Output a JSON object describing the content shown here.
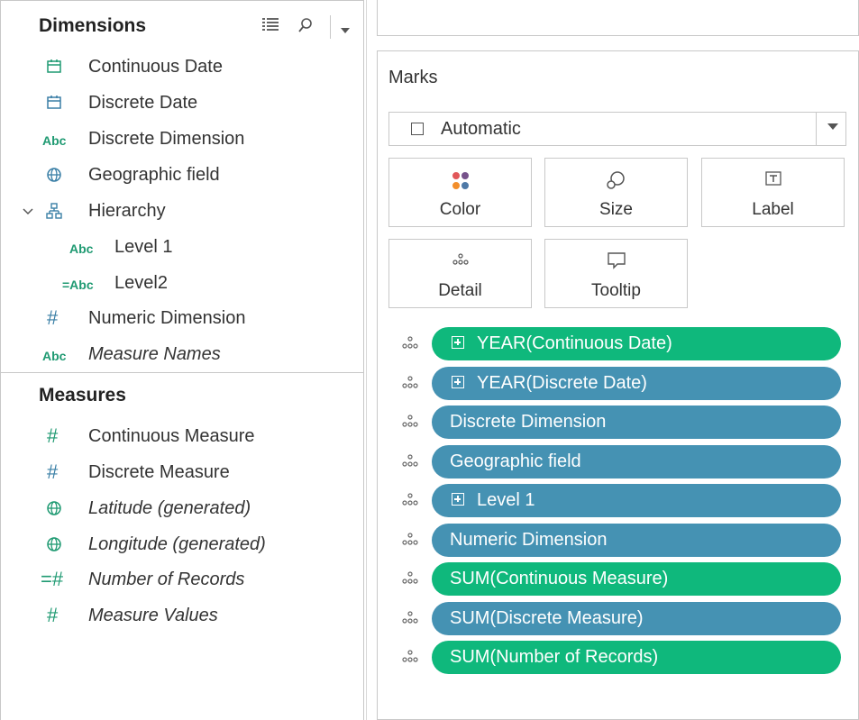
{
  "colors": {
    "continuous": "#0fb87c",
    "discrete": "#4592b3",
    "green_icon": "#1f9a72",
    "blue_icon": "#3a7fa6"
  },
  "dimensions": {
    "title": "Dimensions",
    "items": [
      {
        "icon": "calendar-icon",
        "label": "Continuous Date"
      },
      {
        "icon": "calendar-icon",
        "label": "Discrete Date"
      },
      {
        "icon": "abc-icon",
        "glyph": "Abc",
        "label": "Discrete Dimension"
      },
      {
        "icon": "globe-icon",
        "label": "Geographic field"
      },
      {
        "icon": "hierarchy-icon",
        "label": "Hierarchy"
      },
      {
        "icon": "abc-icon",
        "glyph": "Abc",
        "label": "Level 1"
      },
      {
        "icon": "abc-icon",
        "glyph": "=Abc",
        "label": "Level2"
      },
      {
        "icon": "hash-icon",
        "label": "Numeric Dimension"
      },
      {
        "icon": "abc-icon",
        "glyph": "Abc",
        "label": "Measure Names"
      }
    ]
  },
  "measures": {
    "title": "Measures",
    "items": [
      {
        "icon": "hash-icon",
        "label": "Continuous Measure"
      },
      {
        "icon": "hash-icon",
        "label": "Discrete Measure"
      },
      {
        "icon": "globe-icon",
        "label": "Latitude (generated)"
      },
      {
        "icon": "globe-icon",
        "label": "Longitude (generated)"
      },
      {
        "icon": "hash-icon",
        "glyph": "=#",
        "label": "Number of Records"
      },
      {
        "icon": "hash-icon",
        "label": "Measure Values"
      }
    ]
  },
  "marks": {
    "title": "Marks",
    "mark_type": "Automatic",
    "cards": {
      "color": "Color",
      "size": "Size",
      "label": "Label",
      "detail": "Detail",
      "tooltip": "Tooltip"
    },
    "pills": [
      {
        "label": "YEAR(Continuous Date)",
        "kind": "continuous",
        "expand": true
      },
      {
        "label": "YEAR(Discrete Date)",
        "kind": "discrete",
        "expand": true
      },
      {
        "label": "Discrete Dimension",
        "kind": "discrete",
        "expand": false
      },
      {
        "label": "Geographic field",
        "kind": "discrete",
        "expand": false
      },
      {
        "label": "Level 1",
        "kind": "discrete",
        "expand": true
      },
      {
        "label": "Numeric Dimension",
        "kind": "discrete",
        "expand": false
      },
      {
        "label": "SUM(Continuous Measure)",
        "kind": "continuous",
        "expand": false
      },
      {
        "label": "SUM(Discrete Measure)",
        "kind": "discrete",
        "expand": false
      },
      {
        "label": "SUM(Number of Records)",
        "kind": "continuous",
        "expand": false
      }
    ]
  }
}
